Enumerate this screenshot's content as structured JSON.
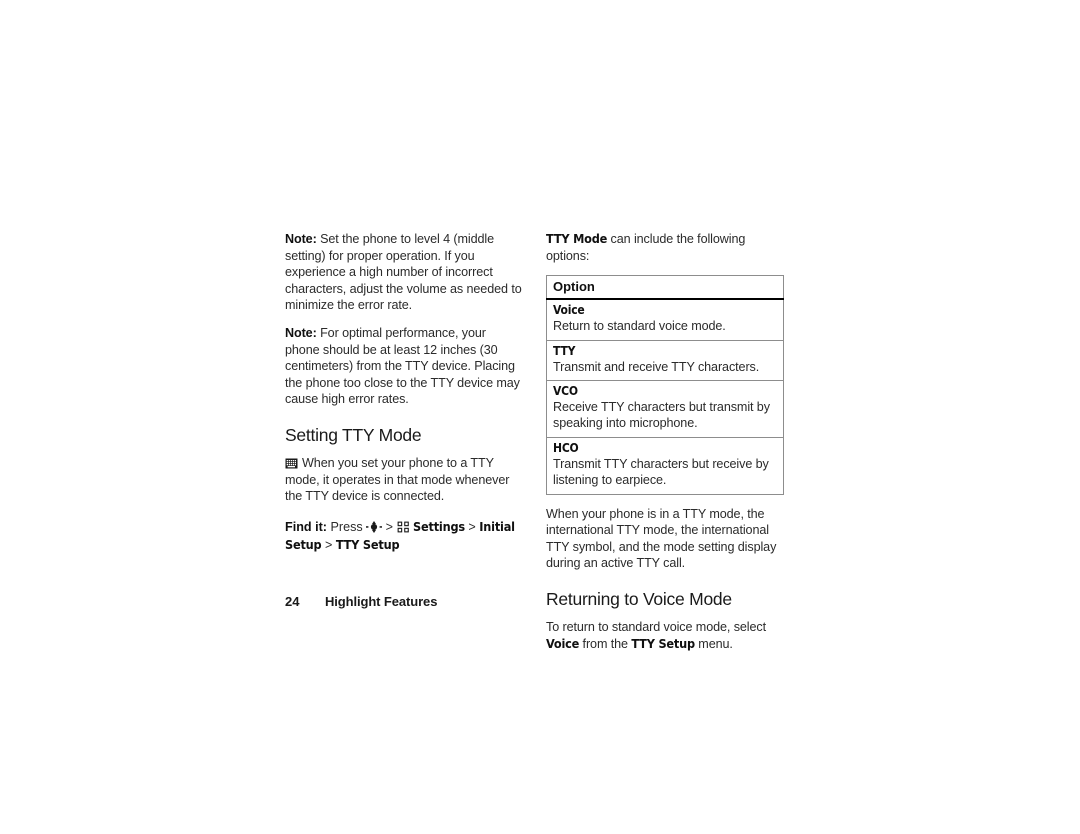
{
  "page": {
    "background": "#ffffff",
    "text_color": "#2b2b2b"
  },
  "left_column": {
    "note1": {
      "label": "Note:",
      "text": " Set the phone to level 4 (middle setting) for proper operation. If you experience a high number of incorrect characters, adjust the volume as needed to minimize the error rate."
    },
    "note2": {
      "label": "Note:",
      "text": " For optimal performance, your phone should be at least 12 inches (30 centimeters) from the TTY device. Placing the phone too close to the TTY device may cause high error rates."
    },
    "heading": "Setting TTY Mode",
    "tty_paragraph": "When you set your phone to a TTY mode, it operates in that mode whenever the TTY device is connected.",
    "find_it": {
      "label": "Find it:",
      "press": "Press",
      "sep1": ">",
      "settings": "Settings",
      "sep2": ">",
      "initial_setup": "Initial Setup",
      "sep3": ">",
      "tty_setup": "TTY Setup",
      "nav_icon": "five-way-navigation-key-icon",
      "menu_icon": "main-menu-icon",
      "tty_device_icon": "tty-device-icon"
    }
  },
  "right_column": {
    "intro": {
      "term": "TTY Mode",
      "text": " can include the following options:"
    },
    "table": {
      "header": "Option",
      "rows": [
        {
          "name": "Voice",
          "desc": "Return to standard voice mode."
        },
        {
          "name": "TTY",
          "desc": "Transmit and receive TTY characters."
        },
        {
          "name": "VCO",
          "desc": "Receive TTY characters but transmit by speaking into microphone."
        },
        {
          "name": "HCO",
          "desc": "Transmit TTY characters but receive by listening to earpiece."
        }
      ]
    },
    "after_table": "When your phone is in a TTY mode, the international TTY mode, the international TTY symbol, and the mode setting display during an active TTY call.",
    "heading": "Returning to Voice Mode",
    "closing": {
      "lead": "To return to standard voice mode, select ",
      "term1": "Voice",
      "mid": " from the ",
      "term2": "TTY Setup",
      "tail": " menu."
    }
  },
  "footer": {
    "page_number": "24",
    "title": "Highlight Features"
  }
}
